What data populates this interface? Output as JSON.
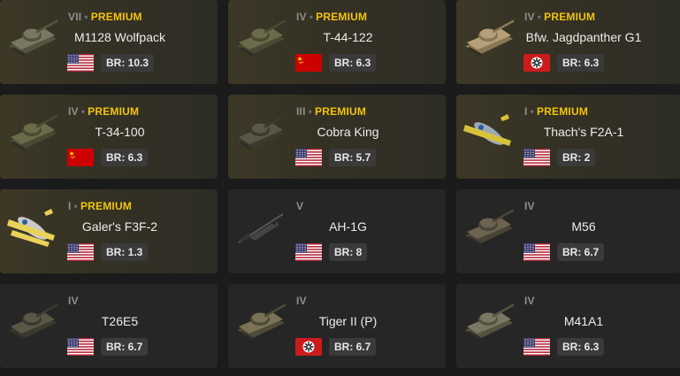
{
  "vehicles": [
    {
      "tier": "VII",
      "premium": true,
      "premium_label": "PREMIUM",
      "name": "M1128 Wolfpack",
      "nation": "usa",
      "br": "BR: 10.3",
      "type": "tank-light"
    },
    {
      "tier": "IV",
      "premium": true,
      "premium_label": "PREMIUM",
      "name": "T-44-122",
      "nation": "ussr",
      "br": "BR: 6.3",
      "type": "tank"
    },
    {
      "tier": "IV",
      "premium": true,
      "premium_label": "PREMIUM",
      "name": "Bfw. Jagdpanther G1",
      "nation": "germany",
      "br": "BR: 6.3",
      "type": "tank-desert"
    },
    {
      "tier": "IV",
      "premium": true,
      "premium_label": "PREMIUM",
      "name": "T-34-100",
      "nation": "ussr",
      "br": "BR: 6.3",
      "type": "tank"
    },
    {
      "tier": "III",
      "premium": true,
      "premium_label": "PREMIUM",
      "name": "Cobra King",
      "nation": "usa",
      "br": "BR: 5.7",
      "type": "tank-dark"
    },
    {
      "tier": "I",
      "premium": true,
      "premium_label": "PREMIUM",
      "name": "Thach's F2A-1",
      "nation": "usa",
      "br": "BR: 2",
      "type": "plane-yellow"
    },
    {
      "tier": "I",
      "premium": true,
      "premium_label": "PREMIUM",
      "name": "Galer's F3F-2",
      "nation": "usa",
      "br": "BR: 1.3",
      "type": "plane-biplane"
    },
    {
      "tier": "V",
      "premium": false,
      "premium_label": "",
      "name": "AH-1G",
      "nation": "usa",
      "br": "BR: 8",
      "type": "helicopter"
    },
    {
      "tier": "IV",
      "premium": false,
      "premium_label": "",
      "name": "M56",
      "nation": "usa",
      "br": "BR: 6.7",
      "type": "tank-spg"
    },
    {
      "tier": "IV",
      "premium": false,
      "premium_label": "",
      "name": "T26E5",
      "nation": "usa",
      "br": "BR: 6.7",
      "type": "tank-dark"
    },
    {
      "tier": "IV",
      "premium": false,
      "premium_label": "",
      "name": "Tiger II (P)",
      "nation": "germany",
      "br": "BR: 6.7",
      "type": "tank-camo"
    },
    {
      "tier": "IV",
      "premium": false,
      "premium_label": "",
      "name": "M41A1",
      "nation": "usa",
      "br": "BR: 6.3",
      "type": "tank-light"
    }
  ],
  "colors": {
    "premium": "#f2c40c",
    "card_bg": "#262626",
    "premium_bg": "#3d3826",
    "br_badge": "#3a3a3a"
  }
}
